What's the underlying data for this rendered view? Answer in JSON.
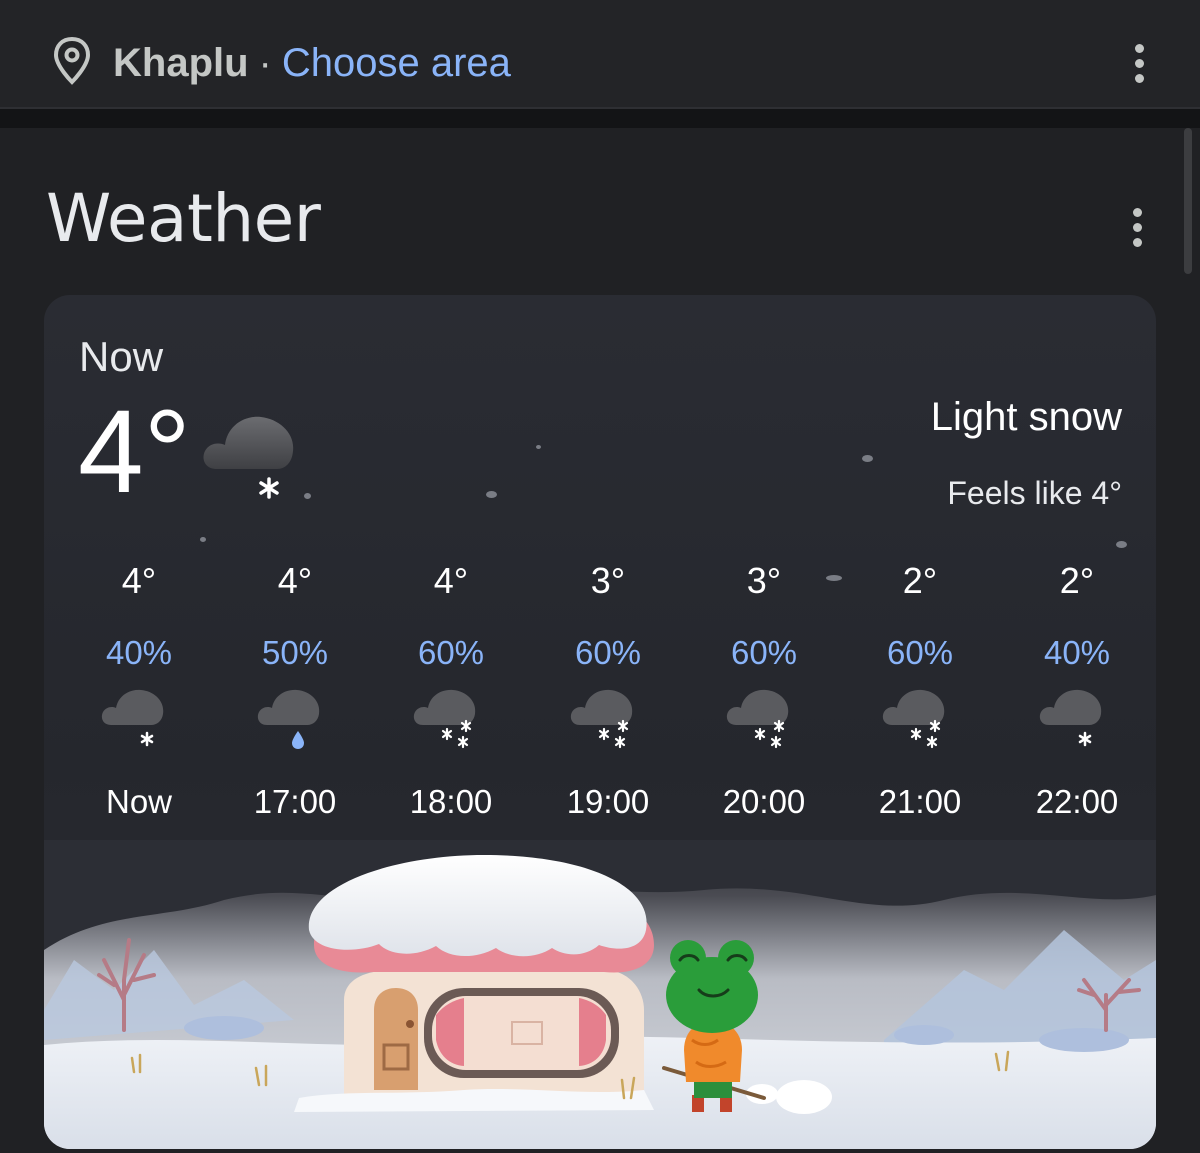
{
  "header": {
    "city": "Khaplu",
    "separator": "·",
    "choose_area": "Choose area"
  },
  "section": {
    "title": "Weather"
  },
  "current": {
    "label": "Now",
    "temperature": "4°",
    "condition": "Light snow",
    "feels_like": "Feels like 4°",
    "icon": "cloud-snow-icon"
  },
  "hourly": [
    {
      "temp": "4°",
      "precip": "40%",
      "time": "Now",
      "icon": "cloud-snow-light-icon"
    },
    {
      "temp": "4°",
      "precip": "50%",
      "time": "17:00",
      "icon": "cloud-rain-icon"
    },
    {
      "temp": "4°",
      "precip": "60%",
      "time": "18:00",
      "icon": "cloud-snow-heavy-icon"
    },
    {
      "temp": "3°",
      "precip": "60%",
      "time": "19:00",
      "icon": "cloud-snow-heavy-icon"
    },
    {
      "temp": "3°",
      "precip": "60%",
      "time": "20:00",
      "icon": "cloud-snow-heavy-icon"
    },
    {
      "temp": "2°",
      "precip": "60%",
      "time": "21:00",
      "icon": "cloud-snow-heavy-icon"
    },
    {
      "temp": "2°",
      "precip": "40%",
      "time": "22:00",
      "icon": "cloud-snow-light-icon"
    }
  ],
  "colors": {
    "accent_blue": "#8ab4f8",
    "background": "#202124",
    "card": "#2a2c33"
  }
}
